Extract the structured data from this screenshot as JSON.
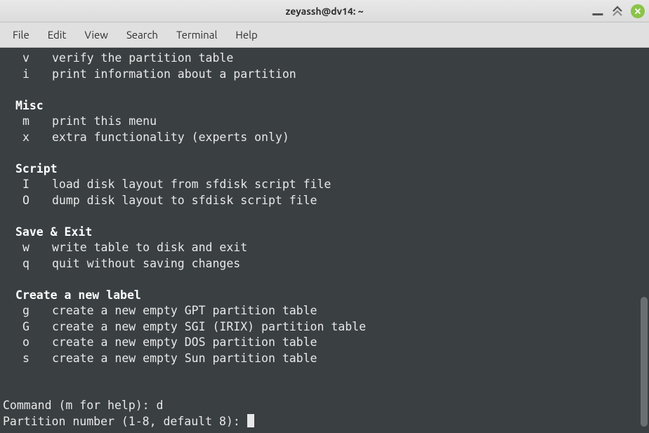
{
  "titlebar": {
    "title": "zeyassh@dv14: ~"
  },
  "menubar": {
    "file": "File",
    "edit": "Edit",
    "view": "View",
    "search": "Search",
    "terminal": "Terminal",
    "help": "Help"
  },
  "terminal": {
    "top_commands": [
      {
        "key": "v",
        "desc": "verify the partition table"
      },
      {
        "key": "i",
        "desc": "print information about a partition"
      }
    ],
    "sections": {
      "misc": {
        "heading": "Misc",
        "items": [
          {
            "key": "m",
            "desc": "print this menu"
          },
          {
            "key": "x",
            "desc": "extra functionality (experts only)"
          }
        ]
      },
      "script": {
        "heading": "Script",
        "items": [
          {
            "key": "I",
            "desc": "load disk layout from sfdisk script file"
          },
          {
            "key": "O",
            "desc": "dump disk layout to sfdisk script file"
          }
        ]
      },
      "save_exit": {
        "heading": "Save & Exit",
        "items": [
          {
            "key": "w",
            "desc": "write table to disk and exit"
          },
          {
            "key": "q",
            "desc": "quit without saving changes"
          }
        ]
      },
      "create_label": {
        "heading": "Create a new label",
        "items": [
          {
            "key": "g",
            "desc": "create a new empty GPT partition table"
          },
          {
            "key": "G",
            "desc": "create a new empty SGI (IRIX) partition table"
          },
          {
            "key": "o",
            "desc": "create a new empty DOS partition table"
          },
          {
            "key": "s",
            "desc": "create a new empty Sun partition table"
          }
        ]
      }
    },
    "prompt1_label": "Command (m for help): ",
    "prompt1_input": "d",
    "prompt2_label": "Partition number (1-8, default 8): "
  }
}
